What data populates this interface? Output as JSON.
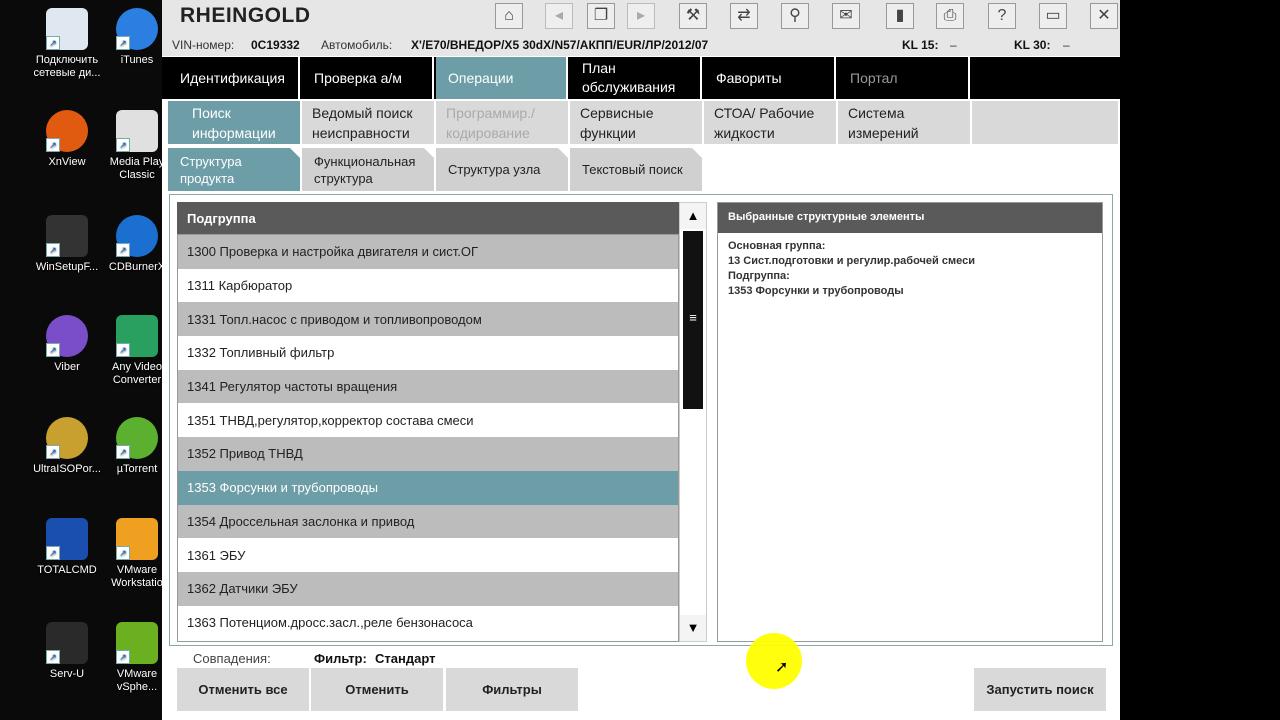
{
  "desktop": {
    "icons": [
      {
        "label": "Подключить сетевые ди...",
        "color": "#dfe8f0"
      },
      {
        "label": "iTunes",
        "color": "#2a7fe0"
      },
      {
        "label": "XnView",
        "color": "#e05a10"
      },
      {
        "label": "Media Play Classic",
        "color": "#e0e0e0"
      },
      {
        "label": "WinSetupF...",
        "color": "#333"
      },
      {
        "label": "CDBurnerX",
        "color": "#1a6fd0"
      },
      {
        "label": "Viber",
        "color": "#7a4ec8"
      },
      {
        "label": "Any Video Converter",
        "color": "#2aa060"
      },
      {
        "label": "UltraISOPor...",
        "color": "#c8a030"
      },
      {
        "label": "µTorrent",
        "color": "#5cb030"
      },
      {
        "label": "TOTALCMD",
        "color": "#1a4fb0"
      },
      {
        "label": "VMware Workstatio",
        "color": "#f0a020"
      },
      {
        "label": "Serv-U",
        "color": "#2a2a2a"
      },
      {
        "label": "VMware vSphe...",
        "color": "#6ab020"
      }
    ]
  },
  "app": {
    "title": "RHEINGOLD",
    "toolbar": [
      "home-icon",
      "back-icon",
      "documents-icon",
      "forward-icon",
      "wrench-icon",
      "transfer-icon",
      "plugin-icon",
      "mail-icon",
      "battery-icon",
      "print-icon",
      "help-icon",
      "window-icon",
      "close-icon"
    ]
  },
  "info": {
    "vin_label": "VIN-номер:",
    "vin_value": "0C19332",
    "car_label": "Автомобиль:",
    "car_value": "X'/E70/ВНЕДОР/X5 30dX/N57/АКПП/EUR/ЛР/2012/07",
    "kl15_label": "KL 15:",
    "kl15_value": "–",
    "kl30_label": "KL 30:",
    "kl30_value": "–"
  },
  "mainnav": [
    "Идентификация",
    "Проверка а/м",
    "Операции",
    "План обслуживания",
    "Фавориты",
    "Портал"
  ],
  "subnav": [
    "Поиск информации",
    "Ведомый поиск неисправности",
    "Программир./ кодирование",
    "Сервисные функции",
    "СТОА/ Рабочие жидкости",
    "Система измерений"
  ],
  "tabs": [
    "Структура продукта",
    "Функциональная структура",
    "Структура узла",
    "Текстовый поиск"
  ],
  "list": {
    "header": "Подгруппа",
    "rows": [
      "1300 Проверка и настройка двигателя и сист.ОГ",
      "1311 Карбюратор",
      "1331 Топл.насос с приводом и топливопроводом",
      "1332 Топливный фильтр",
      "1341 Регулятор частоты вращения",
      "1351 ТНВД,регулятор,корректор состава смеси",
      "1352 Привод ТНВД",
      "1353 Форсунки и трубопроводы",
      "1354 Дроссельная заслонка и привод",
      "1361 ЭБУ",
      "1362 Датчики ЭБУ",
      "1363 Потенциом.дросс.засл.,реле бензонасоса"
    ]
  },
  "detail": {
    "header": "Выбранные структурные элементы",
    "lines": [
      "Основная группа:",
      "13 Сист.подготовки и регулир.рабочей смеси",
      "Подгруппа:",
      "1353 Форсунки и трубопроводы"
    ]
  },
  "status": {
    "matches_label": "Совпадения:",
    "filter_label": "Фильтр:",
    "filter_value": "Стандарт"
  },
  "buttons": {
    "cancel_all": "Отменить все",
    "cancel": "Отменить",
    "filters": "Фильтры",
    "start_search": "Запустить поиск"
  }
}
